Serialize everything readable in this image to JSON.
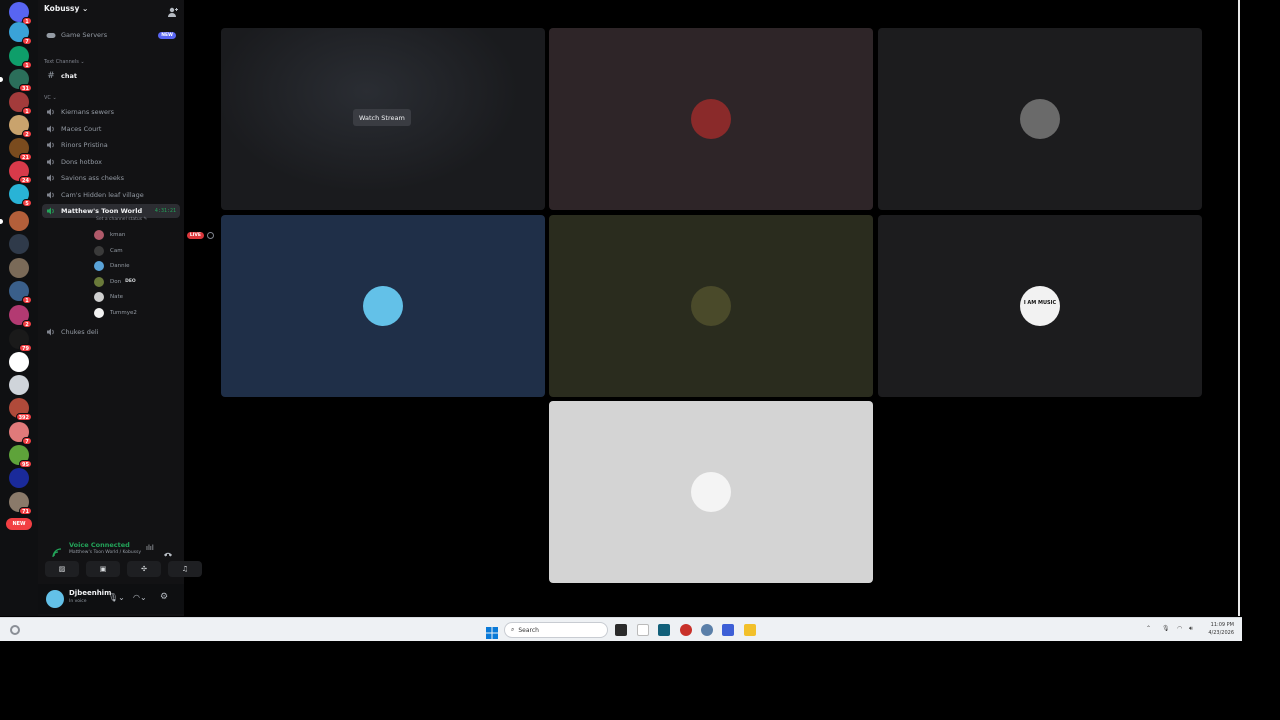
{
  "server_rail": {
    "servers": [
      {
        "name": "discord-home",
        "color": "#5865f2",
        "badge": "1"
      },
      {
        "name": "server-1",
        "color": "#3aa3d8",
        "badge": "7"
      },
      {
        "name": "server-2",
        "color": "#0e9e6a",
        "badge": "1"
      },
      {
        "name": "server-3",
        "color": "#2b6e5a",
        "badge": "31"
      },
      {
        "name": "server-4",
        "color": "#a33b3b",
        "badge": "1"
      },
      {
        "name": "server-5",
        "color": "#c9a36d",
        "badge": "2"
      },
      {
        "name": "server-6",
        "color": "#7a4b1e",
        "badge": "21"
      },
      {
        "name": "server-7",
        "color": "#d83a4a",
        "badge": "24"
      },
      {
        "name": "server-8",
        "color": "#29b3d6",
        "badge": "5"
      },
      {
        "name": "server-9",
        "color": "#b35f3a",
        "badge": ""
      },
      {
        "name": "server-10",
        "color": "#2f3a4a",
        "badge": ""
      },
      {
        "name": "server-11",
        "color": "#7a6a58",
        "badge": ""
      },
      {
        "name": "server-12",
        "color": "#3a5f8a",
        "badge": "1"
      },
      {
        "name": "server-13",
        "color": "#b33a72",
        "badge": "2"
      },
      {
        "name": "server-14",
        "color": "#1a1a1a",
        "badge": "79"
      },
      {
        "name": "server-15",
        "color": "#ffffff",
        "badge": ""
      },
      {
        "name": "server-16",
        "color": "#cfd4da",
        "badge": ""
      },
      {
        "name": "server-17",
        "color": "#b04a3a",
        "badge": "392"
      },
      {
        "name": "server-18",
        "color": "#e07a7a",
        "badge": "7"
      },
      {
        "name": "server-19",
        "color": "#5ea33a",
        "badge": "95"
      },
      {
        "name": "server-20",
        "color": "#1a2a9a",
        "badge": ""
      },
      {
        "name": "server-21",
        "color": "#8a7a6a",
        "badge": "71"
      }
    ],
    "new_label": "NEW"
  },
  "sidebar": {
    "guild_name": "Kobussy",
    "game_servers": {
      "label": "Game Servers",
      "badge": "NEW"
    },
    "text_category": "Text Channels",
    "text_channels": [
      {
        "label": "chat"
      }
    ],
    "voice_category": "VC",
    "voice_channels": [
      {
        "label": "Kiernans sewers"
      },
      {
        "label": "Maces Court"
      },
      {
        "label": "Rinors Pristina"
      },
      {
        "label": "Dons hotbox"
      },
      {
        "label": "Savions ass cheeks"
      },
      {
        "label": "Cam's Hidden leaf village"
      }
    ],
    "active_channel": {
      "label": "Matthew's Toon World",
      "timer": "4:31:21",
      "status": "Set a channel status"
    },
    "members": [
      {
        "name": "kman",
        "color": "#b05a6a",
        "live": "LIVE"
      },
      {
        "name": "Cam",
        "color": "#3a3a3a",
        "tag": ""
      },
      {
        "name": "Dannie",
        "color": "#5aa3d8"
      },
      {
        "name": "Don",
        "color": "#6a7a3a",
        "tag": "DEO"
      },
      {
        "name": "Nate",
        "color": "#cfcfcf"
      },
      {
        "name": "Tummye2",
        "color": "#f2f2f2"
      }
    ],
    "last_channel": {
      "label": "Chukes deli"
    },
    "voice_connected": {
      "title": "Voice Connected",
      "subtitle": "Matthew's Toon World / Kobussy"
    },
    "user": {
      "name": "Djbeenhim",
      "status": "In voice"
    }
  },
  "stage": {
    "watch_label": "Watch Stream",
    "tiles": [
      {
        "name": "kman-stream",
        "bg": "#1a1b1e",
        "stream": true
      },
      {
        "name": "cam-tile",
        "bg": "#2e2528",
        "avatar": "#8a2a2a"
      },
      {
        "name": "nate-tile",
        "bg": "#1c1c1e",
        "avatar": "#6a6a6a"
      },
      {
        "name": "dannie-tile",
        "bg": "#1f2f48",
        "avatar": "#63c1e8"
      },
      {
        "name": "don-tile",
        "bg": "#2a2c1e",
        "avatar": "#4a4a2a"
      },
      {
        "name": "tummye2-tile",
        "bg": "#1c1c1e",
        "avatar": "#f2f2f2",
        "avatar_text": "I AM MUSIC"
      },
      {
        "name": "djbeenhim-tile",
        "bg": "#d4d4d4",
        "avatar": "#f4f4f4"
      }
    ]
  },
  "taskbar": {
    "search_placeholder": "Search",
    "time": "11:09 PM",
    "date": "4/23/2026"
  }
}
